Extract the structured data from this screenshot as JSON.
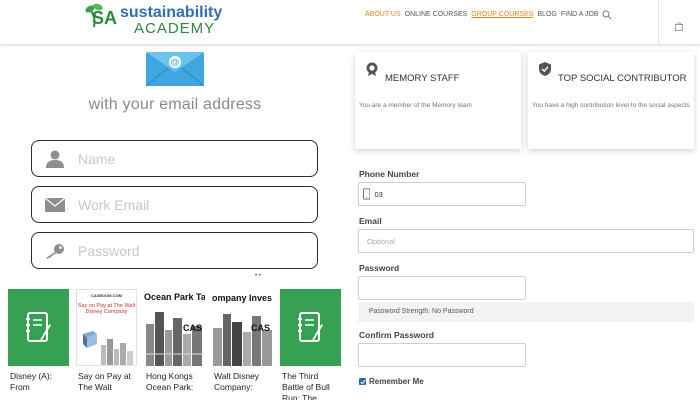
{
  "header": {
    "logo": {
      "mark": "SA",
      "line1": "sustainability",
      "line2": "ACADEMY"
    },
    "nav": [
      {
        "label": "ABOUT US"
      },
      {
        "label": "ONLINE COURSES"
      },
      {
        "label": "GROUP COURSES"
      },
      {
        "label": "BLOG"
      },
      {
        "label": "FIND A JOB"
      }
    ],
    "icons": {
      "search": "search-icon",
      "bag": "shopping-bag-icon"
    },
    "colors": {
      "accent": "#e2841f",
      "logo_blue": "#2e6fb5",
      "logo_green": "#2b8a3e"
    }
  },
  "signup": {
    "heading": "with your email address",
    "name_placeholder": "Name",
    "work_email_placeholder": "Work Email",
    "password_placeholder": "Password"
  },
  "courses": [
    {
      "title": "Disney (A): From",
      "thumb": "green-note"
    },
    {
      "title": "Say on Pay at The Walt",
      "thumb": "case",
      "thumb_brand": "CASEDOM.COM",
      "thumb_title": "Say on Pay at The Walt Disney Company"
    },
    {
      "title": "Hong Kongs Ocean Park:",
      "thumb": "city",
      "thumb_title": "Ocean Park Tal",
      "thumb_code": "CAS"
    },
    {
      "title": "Walt Disney Company:",
      "thumb": "city",
      "thumb_title": "ompany Inves ons Strategy",
      "thumb_code": "CAS"
    },
    {
      "title": "The Third Battle of Bull Run: The",
      "thumb": "green-note"
    }
  ],
  "profile": {
    "badges": [
      {
        "title": "MEMORY STAFF",
        "desc": "You are a member of the Memory team",
        "icon": "staff-badge-icon"
      },
      {
        "title": "TOP SOCIAL CONTRIBUTOR",
        "desc": "You have a high contribution level to the social aspects",
        "icon": "shield-check-icon"
      }
    ],
    "phone_label": "Phone Number",
    "phone_value": "03",
    "email_label": "Email",
    "email_placeholder": "Optional",
    "password_label": "Password",
    "password_strength": "Password Strength: No Password",
    "confirm_label": "Confirm Password",
    "remember_label": "Remember Me",
    "remember_checked": true
  }
}
